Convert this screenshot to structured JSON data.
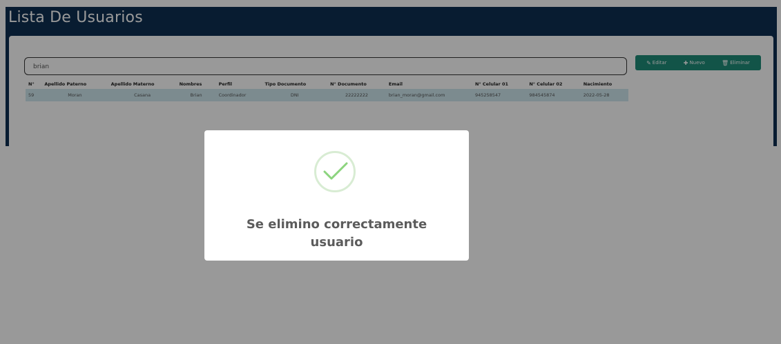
{
  "header": {
    "title": "Lista De Usuarios"
  },
  "search": {
    "value": "brian"
  },
  "actions": {
    "edit": "Editar",
    "new": "Nuevo",
    "delete": "Eliminar"
  },
  "table": {
    "columns": [
      "N°",
      "Apellido Paterno",
      "Apellido Materno",
      "Nombres",
      "Perfil",
      "Tipo Documento",
      "N° Documento",
      "Email",
      "N° Celular 01",
      "N° Celular 02",
      "Nacimiento"
    ],
    "rows": [
      [
        "59",
        "Moran",
        "Casana",
        "Brian",
        "Coordinador",
        "DNI",
        "22222222",
        "brian_moran@gmail.com",
        "945258547",
        "984545874",
        "2022-05-28"
      ]
    ]
  },
  "modal": {
    "line1": "Se elimino correctamente",
    "line2": "usuario"
  },
  "colors": {
    "topbar": "#0e2f52",
    "accent": "#1e8c78",
    "row_highlight": "#cfe8ef",
    "check": "#8cd47e"
  },
  "icons": {
    "edit": "pencil-icon",
    "new": "plus-icon",
    "delete": "trash-icon",
    "success": "check-icon"
  }
}
